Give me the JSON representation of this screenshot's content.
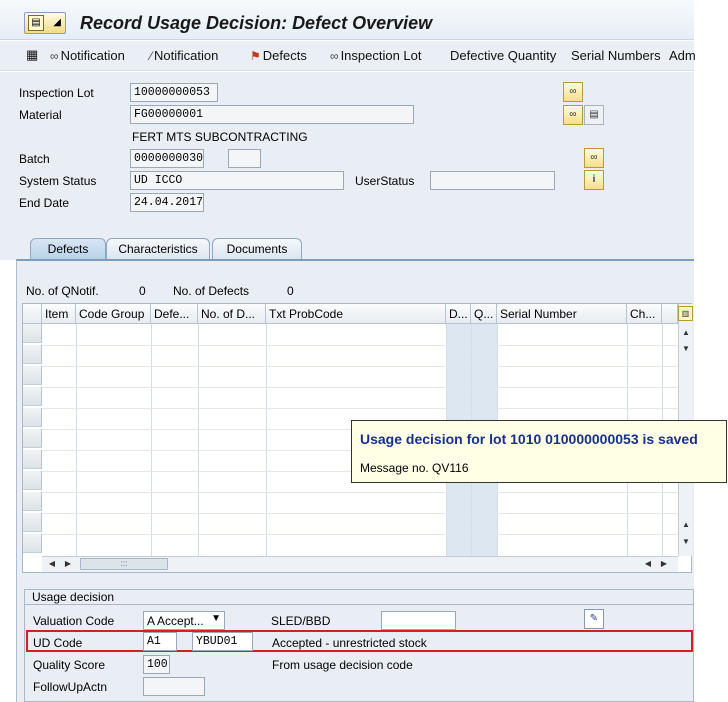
{
  "window": {
    "title": "Record Usage Decision: Defect Overview"
  },
  "toolbar": {
    "items": [
      "Notification",
      "Notification",
      "Defects",
      "Inspection Lot",
      "Defective Quantity",
      "Serial Numbers",
      "Adm"
    ]
  },
  "header": {
    "inspection_lot_label": "Inspection Lot",
    "inspection_lot_value": "10000000053",
    "material_label": "Material",
    "material_value": "FG00000001",
    "material_desc": "FERT MTS SUBCONTRACTING",
    "batch_label": "Batch",
    "batch_value": "0000000030",
    "system_status_label": "System Status",
    "system_status_value": "UD   ICCO",
    "user_status_label": "UserStatus",
    "user_status_value": "",
    "end_date_label": "End Date",
    "end_date_value": "24.04.2017"
  },
  "tabs": [
    {
      "label": "Defects",
      "active": true
    },
    {
      "label": "Characteristics",
      "active": false
    },
    {
      "label": "Documents",
      "active": false
    }
  ],
  "defects_panel": {
    "no_qnotif_label": "No. of QNotif.",
    "no_qnotif_value": "0",
    "no_defects_label": "No. of Defects",
    "no_defects_value": "0",
    "columns": [
      "Item",
      "Code Group",
      "Defe...",
      "No. of D...",
      "Txt ProbCode",
      "D...",
      "Q...",
      "Serial Number",
      "Ch..."
    ]
  },
  "message": {
    "title": "Usage decision for lot 1010 010000000053 is saved",
    "number": "Message no. QV116"
  },
  "usage_decision": {
    "group_title": "Usage decision",
    "valuation_code_label": "Valuation Code",
    "valuation_code_value": "A Accept...",
    "sled_label": "SLED/BBD",
    "sled_value": "",
    "ud_code_label": "UD Code",
    "ud_code_value": "A1",
    "ud_code_group": "YBUD01",
    "ud_code_text": "Accepted - unrestricted stock",
    "quality_score_label": "Quality Score",
    "quality_score_value": "100",
    "quality_score_text": "From usage decision code",
    "followup_label": "FollowUpActn",
    "followup_value": ""
  },
  "colors": {
    "highlight_border": "#d81e1e",
    "message_title": "#16308f",
    "background": "#e8eef4"
  }
}
